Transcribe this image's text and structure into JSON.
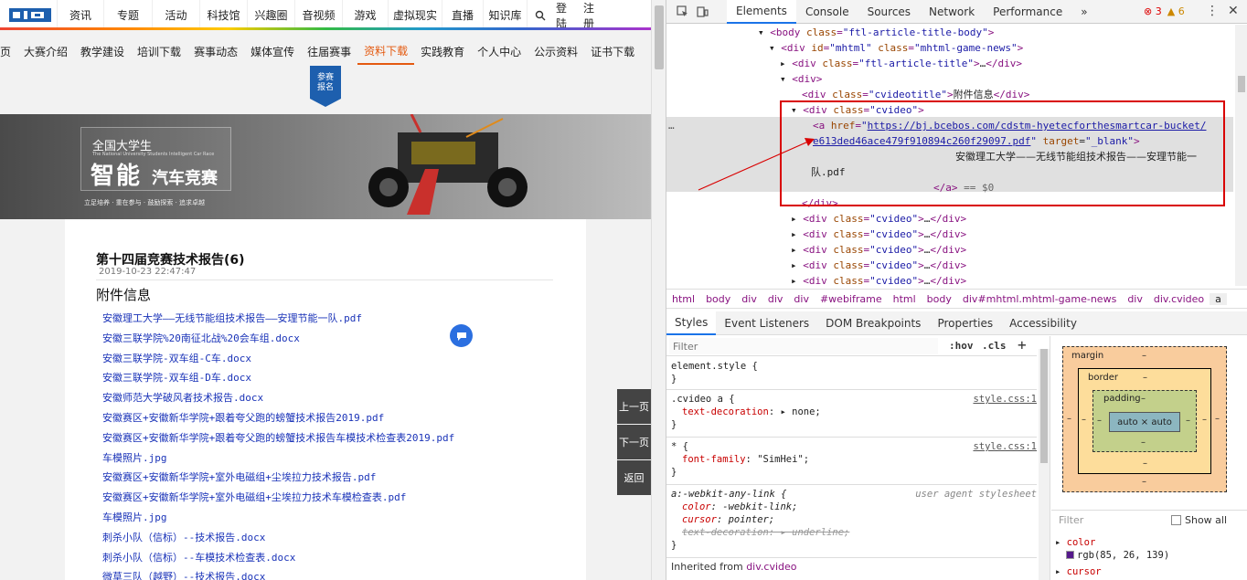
{
  "webpage": {
    "topnav": [
      "资讯",
      "专题",
      "活动",
      "科技馆",
      "兴趣圈",
      "音视频",
      "游戏",
      "虚拟现实",
      "直播",
      "知识库"
    ],
    "login": "登陆",
    "register": "注册",
    "subnav": [
      "页",
      "大赛介绍",
      "教学建设",
      "培训下载",
      "赛事动态",
      "媒体宣传",
      "往届赛事",
      "资料下载",
      "实践教育",
      "个人中心",
      "公示资料",
      "证书下载"
    ],
    "subnav_active": "资料下载",
    "badge": [
      "参赛",
      "报名"
    ],
    "banner": {
      "line1": "全国大学生",
      "line1_en": "The National University Students Intelligent Car Race",
      "line2": "智能",
      "line2b": "汽车竞赛",
      "line3": "立足培养 · 重在参与 · 鼓励探索 · 追求卓越"
    },
    "article": {
      "title": "第十四届竞赛技术报告(6)",
      "date": "2019-10-23  22:47:47",
      "attach_heading": "附件信息",
      "files": [
        "安徽理工大学——无线节能组技术报告——安理节能一队.pdf",
        "安徽三联学院%20南征北战%20会车组.docx",
        "安徽三联学院-双车组-C车.docx",
        "安徽三联学院-双车组-D车.docx",
        "安徽师范大学破风者技术报告.docx",
        "安徽赛区+安徽新华学院+跟着夸父跑的螃蟹技术报告2019.pdf",
        "安徽赛区+安徽新华学院+跟着夸父跑的螃蟹技术报告车模技术检查表2019.pdf",
        "车模照片.jpg",
        "安徽赛区+安徽新华学院+室外电磁组+尘埃拉力技术报告.pdf",
        "安徽赛区+安徽新华学院+室外电磁组+尘埃拉力技术车模检查表.pdf",
        "车模照片.jpg",
        "刺杀小队（信标）--技术报告.docx",
        "刺杀小队（信标）--车模技术检查表.docx",
        "微草三队（越野）--技术报告.docx"
      ]
    },
    "pager": [
      "上一页",
      "下一页",
      "返回"
    ]
  },
  "devtools": {
    "tabs": [
      "Elements",
      "Console",
      "Sources",
      "Network",
      "Performance"
    ],
    "active_tab": "Elements",
    "more": "»",
    "errors": "3",
    "warnings": "6",
    "dom": {
      "l1_tag": "body",
      "l1_attr": "class",
      "l1_val": "\"ftl-article-title-body\"",
      "l2_tag": "div",
      "l2_attr1": "id",
      "l2_val1": "\"mhtml\"",
      "l2_attr2": "class",
      "l2_val2": "\"mhtml-game-news\"",
      "l3_attr": "class",
      "l3_val": "\"ftl-article-title\"",
      "l4_tag": "div",
      "l5_attr": "class",
      "l5_val": "\"cvideotitle\"",
      "l5_text": "附件信息",
      "l6_attr": "class",
      "l6_val": "\"cvideo\"",
      "href_attr": "href",
      "href1": "https://bj.bcebos.com/cdstm-hyetecforthesmartcar-bucket/",
      "href2": "e613ded46ace479f910894c260f29097.pdf",
      "target_attr": "target",
      "target_val": "\"_blank\"",
      "link_text1": "安徽理工大学——无线节能组技术报告——安理节能一",
      "link_text2": "队.pdf",
      "eq": "== $0",
      "collapsed_attr": "class",
      "collapsed_val": "\"cvideo\"",
      "collapsed_count": 5,
      "ellipsis": "…"
    },
    "crumbs": [
      "html",
      "body",
      "div",
      "div",
      "div",
      "#webiframe",
      "html",
      "body",
      "div#mhtml.mhtml-game-news",
      "div",
      "div.cvideo",
      "a"
    ],
    "subtabs": [
      "Styles",
      "Event Listeners",
      "DOM Breakpoints",
      "Properties",
      "Accessibility"
    ],
    "active_subtab": "Styles",
    "filter_placeholder": "Filter",
    "hov": ":hov",
    "cls": ".cls",
    "rules": {
      "r1_sel": "element.style {",
      "r2_sel": ".cvideo a {",
      "r2_src": "style.css:1",
      "r2_prop": "text-decoration",
      "r2_val": "none;",
      "r3_sel": "* {",
      "r3_src": "style.css:1",
      "r3_prop": "font-family",
      "r3_val": "\"SimHei\";",
      "r4_sel": "a:-webkit-any-link {",
      "r4_src": "user agent stylesheet",
      "r4_p1": "color",
      "r4_v1": "-webkit-link;",
      "r4_p2": "cursor",
      "r4_v2": "pointer;",
      "r4_p3": "text-decoration",
      "r4_v3": "underline;",
      "close": "}",
      "inherited_label": "Inherited from",
      "inherited_sel": "div.cvideo"
    },
    "boxmodel": {
      "margin": "margin",
      "border": "border",
      "padding": "padding",
      "content": "auto × auto",
      "dash": "–"
    },
    "computed": {
      "filter": "Filter",
      "show_all": "Show all",
      "p1": "color",
      "v1": "rgb(85, 26, 139)",
      "p2": "cursor",
      "swatch_color": "#55198b"
    }
  }
}
